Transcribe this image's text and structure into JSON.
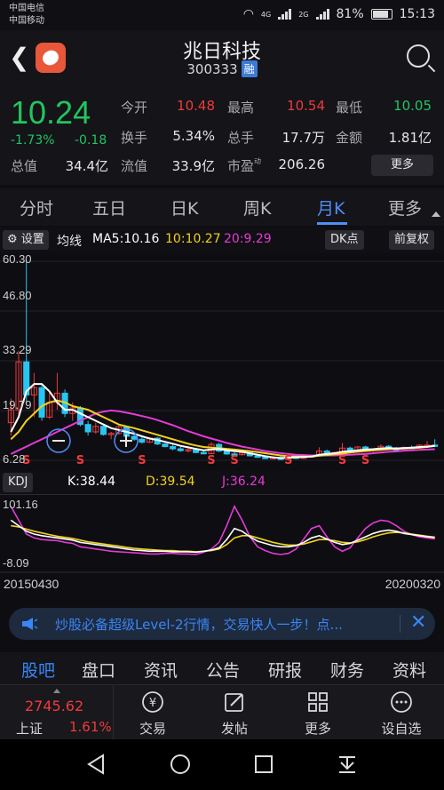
{
  "status_bar": {
    "carrier_1": "中国电信",
    "carrier_2": "中国移动",
    "network_4g": "4G",
    "network_2g": "2G",
    "battery": "81%",
    "time": "15:13"
  },
  "header": {
    "stock_name": "兆日科技",
    "stock_code": "300333",
    "margin_badge": "融",
    "back_icon": "chevron-left-icon",
    "search_icon": "search-icon"
  },
  "quote": {
    "price": "10.24",
    "change_pct": "-1.73%",
    "change": "-0.18",
    "open_label": "今开",
    "open": "10.48",
    "high_label": "最高",
    "high": "10.54",
    "low_label": "最低",
    "low": "10.05",
    "turnover_label": "换手",
    "turnover": "5.34%",
    "volume_label": "总手",
    "volume": "17.7万",
    "amount_label": "金额",
    "amount": "1.81亿",
    "total_cap_label": "总值",
    "total_cap": "34.4亿",
    "float_cap_label": "流值",
    "float_cap": "33.9亿",
    "pe_label": "市盈",
    "pe_sup": "动",
    "pe": "206.26",
    "more_button": "更多"
  },
  "period_tabs": [
    "分时",
    "五日",
    "日K",
    "周K",
    "月K",
    "更多"
  ],
  "active_period": "月K",
  "indicator_bar": {
    "settings": "设置",
    "ma_label": "均线",
    "ma5": "MA5:10.16",
    "ma10": "10:10.27",
    "ma20": "20:9.29",
    "dk_button": "DK点",
    "adjust_button": "前复权"
  },
  "price_axis": {
    "labels": [
      "60.30",
      "46.80",
      "33.29",
      "19.79",
      "6.28"
    ]
  },
  "kdj": {
    "label": "KDJ",
    "k": "K:38.44",
    "d": "D:39.54",
    "j": "J:36.24",
    "axis_top": "101.16",
    "axis_bottom": "-8.09",
    "date_start": "20150430",
    "date_end": "20200320"
  },
  "chart_markers": {
    "sell": "S",
    "zoom_out_icon": "minus-circle-icon",
    "zoom_in_icon": "plus-circle-icon"
  },
  "ad_banner": {
    "text": "炒股必备超级Level-2行情，交易快人一步！点...",
    "speaker_icon": "speaker-icon",
    "close_icon": "close-icon"
  },
  "bottom_tabs": [
    "股吧",
    "盘口",
    "资讯",
    "公告",
    "研报",
    "财务",
    "资料"
  ],
  "active_bottom_tab": "股吧",
  "index": {
    "value": "2745.62",
    "name": "上证",
    "pct": "1.61%"
  },
  "toolbar": [
    {
      "label": "交易",
      "icon": "yuan-circle-icon"
    },
    {
      "label": "发帖",
      "icon": "edit-icon"
    },
    {
      "label": "更多",
      "icon": "grid-icon"
    },
    {
      "label": "设自选",
      "icon": "more-circle-icon"
    }
  ],
  "colors": {
    "up": "#ef3b3b",
    "down": "#22c55e",
    "accent": "#4f8ef7",
    "ma5": "#ffffff",
    "ma10": "#f2d21b",
    "ma20": "#e53ad6"
  },
  "chart_data": {
    "type": "candlestick",
    "period": "monthly",
    "y_axis_labels": [
      60.3,
      46.8,
      33.29,
      19.79,
      6.28
    ],
    "ylim": [
      6.28,
      60.3
    ],
    "x_range": [
      "20150430",
      "20200320"
    ],
    "candles": [
      {
        "o": 16.5,
        "h": 23.0,
        "l": 13.0,
        "c": 20.0
      },
      {
        "o": 20.0,
        "h": 36.0,
        "l": 18.0,
        "c": 33.0
      },
      {
        "o": 33.0,
        "h": 60.3,
        "l": 22.0,
        "c": 24.0
      },
      {
        "o": 24.0,
        "h": 30.0,
        "l": 18.0,
        "c": 26.0
      },
      {
        "o": 26.0,
        "h": 27.0,
        "l": 17.0,
        "c": 18.0
      },
      {
        "o": 18.0,
        "h": 25.0,
        "l": 17.5,
        "c": 22.0
      },
      {
        "o": 22.0,
        "h": 30.0,
        "l": 20.0,
        "c": 24.5
      },
      {
        "o": 24.5,
        "h": 25.5,
        "l": 18.0,
        "c": 19.0
      },
      {
        "o": 19.0,
        "h": 22.0,
        "l": 17.0,
        "c": 20.5
      },
      {
        "o": 20.5,
        "h": 21.0,
        "l": 15.5,
        "c": 16.0
      },
      {
        "o": 16.0,
        "h": 17.0,
        "l": 13.0,
        "c": 14.0
      },
      {
        "o": 14.0,
        "h": 16.5,
        "l": 13.5,
        "c": 15.5
      },
      {
        "o": 15.5,
        "h": 15.8,
        "l": 13.0,
        "c": 13.3
      },
      {
        "o": 13.3,
        "h": 14.0,
        "l": 12.0,
        "c": 13.6
      },
      {
        "o": 13.6,
        "h": 16.0,
        "l": 13.2,
        "c": 15.4
      },
      {
        "o": 15.4,
        "h": 15.6,
        "l": 12.5,
        "c": 12.8
      },
      {
        "o": 12.8,
        "h": 13.2,
        "l": 11.6,
        "c": 12.0
      },
      {
        "o": 12.0,
        "h": 12.5,
        "l": 10.8,
        "c": 11.2
      },
      {
        "o": 11.2,
        "h": 12.6,
        "l": 11.0,
        "c": 12.3
      },
      {
        "o": 12.3,
        "h": 12.6,
        "l": 10.4,
        "c": 10.7
      },
      {
        "o": 10.7,
        "h": 11.0,
        "l": 9.8,
        "c": 10.0
      },
      {
        "o": 10.0,
        "h": 10.6,
        "l": 9.0,
        "c": 9.4
      },
      {
        "o": 9.4,
        "h": 9.9,
        "l": 8.6,
        "c": 8.9
      },
      {
        "o": 8.9,
        "h": 9.6,
        "l": 8.4,
        "c": 9.2
      },
      {
        "o": 9.2,
        "h": 9.5,
        "l": 8.2,
        "c": 8.4
      },
      {
        "o": 8.4,
        "h": 9.0,
        "l": 7.9,
        "c": 8.1
      },
      {
        "o": 8.1,
        "h": 11.2,
        "l": 8.0,
        "c": 10.6
      },
      {
        "o": 10.6,
        "h": 11.0,
        "l": 8.5,
        "c": 8.8
      },
      {
        "o": 8.8,
        "h": 9.2,
        "l": 7.8,
        "c": 8.0
      },
      {
        "o": 8.0,
        "h": 8.5,
        "l": 7.5,
        "c": 7.8
      },
      {
        "o": 7.8,
        "h": 8.6,
        "l": 7.6,
        "c": 8.3
      },
      {
        "o": 8.3,
        "h": 8.6,
        "l": 7.3,
        "c": 7.5
      },
      {
        "o": 7.5,
        "h": 7.8,
        "l": 6.9,
        "c": 7.1
      },
      {
        "o": 7.1,
        "h": 7.4,
        "l": 6.6,
        "c": 6.8
      },
      {
        "o": 6.8,
        "h": 7.3,
        "l": 6.5,
        "c": 7.0
      },
      {
        "o": 7.0,
        "h": 7.4,
        "l": 6.3,
        "c": 6.5
      },
      {
        "o": 6.5,
        "h": 7.6,
        "l": 6.4,
        "c": 7.3
      },
      {
        "o": 7.3,
        "h": 7.6,
        "l": 6.6,
        "c": 6.8
      },
      {
        "o": 6.8,
        "h": 7.4,
        "l": 6.6,
        "c": 7.2
      },
      {
        "o": 7.2,
        "h": 7.8,
        "l": 7.0,
        "c": 7.5
      },
      {
        "o": 7.5,
        "h": 9.8,
        "l": 7.4,
        "c": 8.8
      },
      {
        "o": 8.8,
        "h": 9.2,
        "l": 7.6,
        "c": 7.9
      },
      {
        "o": 7.9,
        "h": 8.6,
        "l": 7.6,
        "c": 8.4
      },
      {
        "o": 8.4,
        "h": 11.0,
        "l": 8.2,
        "c": 9.6
      },
      {
        "o": 9.6,
        "h": 10.0,
        "l": 8.5,
        "c": 8.8
      },
      {
        "o": 8.8,
        "h": 10.2,
        "l": 8.6,
        "c": 9.9
      },
      {
        "o": 9.9,
        "h": 10.2,
        "l": 8.8,
        "c": 9.1
      },
      {
        "o": 9.1,
        "h": 9.6,
        "l": 8.6,
        "c": 9.4
      },
      {
        "o": 9.4,
        "h": 10.6,
        "l": 9.0,
        "c": 10.1
      },
      {
        "o": 10.1,
        "h": 10.4,
        "l": 9.2,
        "c": 9.5
      },
      {
        "o": 9.5,
        "h": 9.9,
        "l": 8.7,
        "c": 9.0
      },
      {
        "o": 9.0,
        "h": 10.0,
        "l": 8.8,
        "c": 9.8
      },
      {
        "o": 9.8,
        "h": 10.3,
        "l": 9.3,
        "c": 9.6
      },
      {
        "o": 9.6,
        "h": 10.6,
        "l": 9.4,
        "c": 10.4
      },
      {
        "o": 10.4,
        "h": 11.5,
        "l": 10.0,
        "c": 10.42
      },
      {
        "o": 10.42,
        "h": 12.0,
        "l": 10.0,
        "c": 10.24
      }
    ],
    "ma5": [
      14,
      18,
      25,
      27,
      27,
      25,
      22,
      20,
      20,
      19,
      18,
      17,
      16,
      15,
      14.5,
      14,
      13.5,
      12.8,
      12.2,
      11.8,
      11.3,
      10.8,
      10.2,
      9.8,
      9.4,
      9.0,
      9.2,
      9.4,
      9.0,
      8.8,
      8.6,
      8.2,
      7.8,
      7.4,
      7.1,
      6.9,
      7.0,
      7.1,
      7.2,
      7.3,
      7.8,
      8.0,
      8.2,
      8.6,
      8.8,
      9.0,
      9.2,
      9.3,
      9.5,
      9.6,
      9.5,
      9.6,
      9.7,
      9.9,
      10.0,
      10.16
    ],
    "ma10": [
      12,
      14,
      17,
      19,
      21,
      22,
      22.5,
      22,
      21,
      20.5,
      20,
      19,
      18,
      17,
      16,
      15.5,
      15,
      14.4,
      13.8,
      13.2,
      12.6,
      12.0,
      11.4,
      10.8,
      10.3,
      9.9,
      9.7,
      9.6,
      9.4,
      9.2,
      9.0,
      8.8,
      8.5,
      8.2,
      7.9,
      7.6,
      7.4,
      7.3,
      7.3,
      7.3,
      7.5,
      7.7,
      7.9,
      8.1,
      8.4,
      8.6,
      8.8,
      9.0,
      9.1,
      9.3,
      9.4,
      9.5,
      9.6,
      9.7,
      9.9,
      10.27
    ],
    "ma20": [
      8,
      9,
      10,
      11,
      12,
      13,
      14,
      15,
      16,
      17,
      18,
      19,
      19.5,
      19.8,
      19.6,
      19.2,
      18.8,
      18.3,
      17.8,
      17.2,
      16.5,
      15.8,
      15.0,
      14.2,
      13.5,
      12.8,
      12.2,
      11.6,
      11.0,
      10.5,
      10.0,
      9.6,
      9.2,
      8.8,
      8.5,
      8.2,
      8.0,
      7.8,
      7.7,
      7.6,
      7.6,
      7.6,
      7.6,
      7.7,
      7.8,
      7.9,
      8.0,
      8.2,
      8.4,
      8.6,
      8.7,
      8.9,
      9.0,
      9.1,
      9.2,
      9.29
    ],
    "kdj_ylim": [
      -8.09,
      101.16
    ],
    "k": [
      70,
      60,
      50,
      45,
      42,
      40,
      38,
      36,
      34,
      30,
      28,
      26,
      24,
      22,
      20,
      18,
      16,
      15,
      14,
      14,
      14,
      13,
      13,
      13,
      12,
      14,
      16,
      20,
      35,
      55,
      50,
      40,
      32,
      28,
      24,
      22,
      22,
      24,
      30,
      38,
      42,
      36,
      30,
      26,
      28,
      34,
      40,
      46,
      50,
      52,
      50,
      46,
      44,
      42,
      40,
      38.44
    ],
    "d": [
      60,
      58,
      54,
      50,
      47,
      44,
      41,
      39,
      37,
      34,
      31,
      29,
      27,
      25,
      23,
      21,
      19,
      18,
      17,
      16,
      15,
      15,
      14,
      14,
      13,
      14,
      15,
      18,
      26,
      38,
      42,
      42,
      38,
      34,
      30,
      27,
      25,
      25,
      27,
      31,
      35,
      35,
      33,
      30,
      29,
      31,
      35,
      40,
      44,
      47,
      48,
      47,
      45,
      43,
      41,
      39.54
    ],
    "j": [
      95,
      70,
      45,
      38,
      35,
      34,
      33,
      30,
      28,
      22,
      20,
      18,
      16,
      14,
      13,
      12,
      11,
      10,
      9,
      9,
      10,
      10,
      9,
      9,
      8,
      12,
      18,
      30,
      60,
      95,
      70,
      40,
      22,
      15,
      10,
      8,
      10,
      18,
      36,
      55,
      60,
      40,
      22,
      14,
      20,
      38,
      55,
      65,
      70,
      68,
      60,
      50,
      44,
      40,
      38,
      36.24
    ]
  }
}
